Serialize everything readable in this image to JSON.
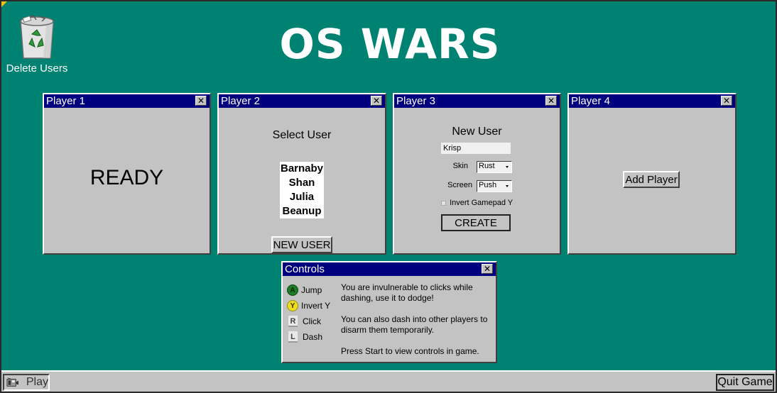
{
  "desktop": {
    "icon_name": "recycle-bin-icon",
    "icon_label": "Delete Users"
  },
  "title": "OS WARS",
  "players": [
    {
      "title": "Player 1",
      "status": "READY"
    },
    {
      "title": "Player 2",
      "heading": "Select User",
      "users": [
        "Barnaby",
        "Shan",
        "Julia",
        "Beanup"
      ],
      "new_user_label": "NEW USER"
    },
    {
      "title": "Player 3",
      "heading": "New User",
      "name_value": "Krisp",
      "skin_label": "Skin",
      "skin_value": "Rust",
      "screen_label": "Screen",
      "screen_value": "Push",
      "invert_label": "Invert Gamepad Y",
      "create_label": "CREATE"
    },
    {
      "title": "Player 4",
      "add_label": "Add Player"
    }
  ],
  "controls": {
    "title": "Controls",
    "items": [
      {
        "glyph": "A",
        "label": "Jump",
        "color": "#1d7a25"
      },
      {
        "glyph": "Y",
        "label": "Invert Y",
        "color": "#ecdc22"
      },
      {
        "glyph": "R",
        "label": "Click"
      },
      {
        "glyph": "L",
        "label": "Dash"
      }
    ],
    "tips": [
      "You are invulnerable to clicks while dashing, use it to dodge!",
      "You can also dash into other players to disarm them temporarily.",
      "Press Start to view controls in game."
    ]
  },
  "taskbar": {
    "play_label": "Play",
    "quit_label": "Quit Game"
  },
  "colors": {
    "desktop": "#008272",
    "titlebar": "#00007e",
    "window": "#c3c3c3"
  }
}
